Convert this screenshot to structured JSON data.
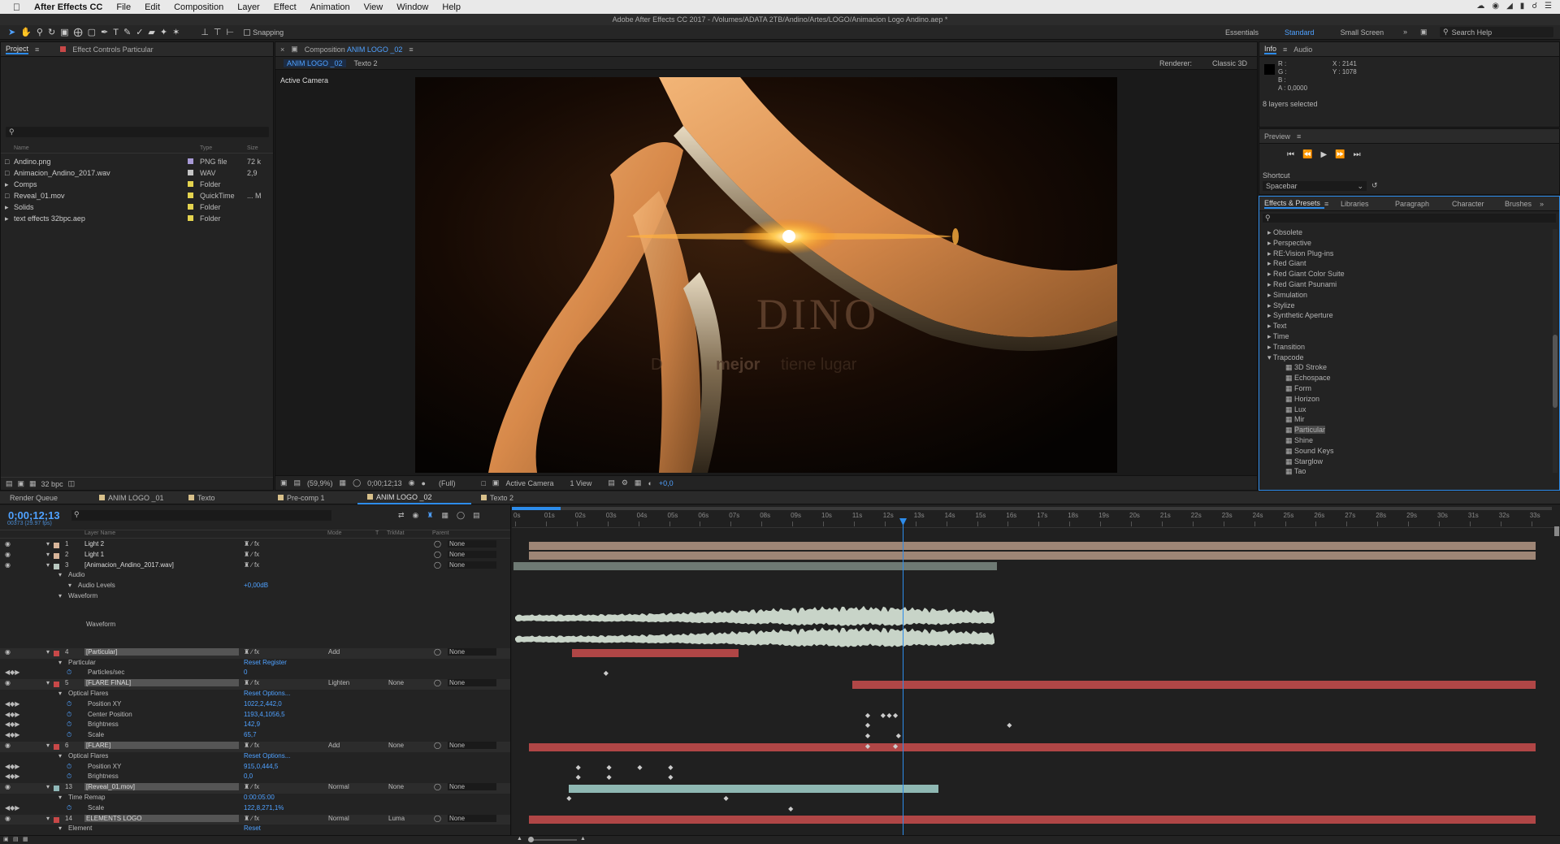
{
  "menubar": {
    "app": "After Effects CC",
    "items": [
      "File",
      "Edit",
      "Composition",
      "Layer",
      "Effect",
      "Animation",
      "View",
      "Window",
      "Help"
    ]
  },
  "window": {
    "title": "Adobe After Effects CC 2017 - /Volumes/ADATA 2TB/Andino/Artes/LOGO/Animacion Logo Andino.aep *"
  },
  "toolbar": {
    "snapping": "Snapping",
    "workspaces": [
      "Essentials",
      "Standard",
      "Small Screen"
    ],
    "search_help": "Search Help"
  },
  "project": {
    "tab": "Project",
    "effect_controls": "Effect Controls Particular",
    "columns": [
      "Name",
      "Type",
      "Size"
    ],
    "items": [
      {
        "name": "Andino.png",
        "type": "PNG file",
        "size": "72 k",
        "color": "#a89ad6",
        "folder": false
      },
      {
        "name": "Animacion_Andino_2017.wav",
        "type": "WAV",
        "size": "2,9",
        "color": "#c4c4c4",
        "folder": false
      },
      {
        "name": "Comps",
        "type": "Folder",
        "size": "",
        "color": "#e5d44f",
        "folder": true
      },
      {
        "name": "Reveal_01.mov",
        "type": "QuickTime",
        "size": "... M",
        "color": "#e5d44f",
        "folder": false
      },
      {
        "name": "Solids",
        "type": "Folder",
        "size": "",
        "color": "#e5d44f",
        "folder": true
      },
      {
        "name": "text effects 32bpc.aep",
        "type": "Folder",
        "size": "",
        "color": "#e5d44f",
        "folder": true
      }
    ],
    "bpc": "32 bpc"
  },
  "composition": {
    "tab_label": "Composition",
    "comp_name": "ANIM LOGO _02",
    "subtabs": [
      "ANIM LOGO _02",
      "Texto 2"
    ],
    "renderer_label": "Renderer:",
    "renderer": "Classic 3D",
    "camera_label": "Active Camera",
    "logo_text": "DINO",
    "tagline_a": "D",
    "tagline_b": "mejor",
    "tagline_c": "tiene lugar",
    "footer": {
      "zoom": "(59,9%)",
      "timecode": "0;00;12;13",
      "resolution": "(Full)",
      "camera": "Active Camera",
      "views": "1 View",
      "exposure": "+0,0"
    }
  },
  "info": {
    "tabs": [
      "Info",
      "Audio"
    ],
    "r": "R :",
    "g": "G :",
    "b": "B :",
    "a": "A : 0,0000",
    "x": "X : 2141",
    "y": "Y : 1078",
    "selected": "8 layers selected"
  },
  "preview": {
    "title": "Preview",
    "shortcut_label": "Shortcut",
    "shortcut": "Spacebar"
  },
  "effects": {
    "tabs": [
      "Effects & Presets",
      "Libraries",
      "Paragraph",
      "Character",
      "Brushes"
    ],
    "categories": [
      "Obsolete",
      "Perspective",
      "RE:Vision Plug-ins",
      "Red Giant",
      "Red Giant Color Suite",
      "Red Giant Psunami",
      "Simulation",
      "Stylize",
      "Synthetic Aperture",
      "Text",
      "Time",
      "Transition"
    ],
    "open_category": "Trapcode",
    "plugins": [
      "3D Stroke",
      "Echospace",
      "Form",
      "Horizon",
      "Lux",
      "Mir",
      "Particular",
      "Shine",
      "Sound Keys",
      "Starglow",
      "Tao"
    ],
    "selected": "Particular"
  },
  "timeline": {
    "tabs": [
      "Render Queue",
      "ANIM LOGO _01",
      "Texto",
      "Pre-comp 1",
      "ANIM LOGO _02",
      "Texto 2"
    ],
    "active_tab": "ANIM LOGO _02",
    "timecode": "0;00;12;13",
    "frames": "00373 (29.97 fps)",
    "columns": {
      "layer_name": "Layer Name",
      "mode": "Mode",
      "t": "T",
      "trkmat": "TrkMat",
      "parent": "Parent"
    },
    "ruler": [
      "0s",
      "01s",
      "02s",
      "03s",
      "04s",
      "05s",
      "06s",
      "07s",
      "08s",
      "09s",
      "10s",
      "11s",
      "12s",
      "13s",
      "14s",
      "15s",
      "16s",
      "17s",
      "18s",
      "19s",
      "20s",
      "21s",
      "22s",
      "23s",
      "24s",
      "25s",
      "26s",
      "27s",
      "28s",
      "29s",
      "30s",
      "31s",
      "32s",
      "33s"
    ],
    "rows": [
      {
        "kind": "layer",
        "num": "1",
        "name": "Light 2",
        "mode": "",
        "trk": "",
        "parent": "None",
        "color": "#d8b59a",
        "bar": {
          "start": 0.5,
          "end": 33.2,
          "color": "#9e8676"
        }
      },
      {
        "kind": "layer",
        "num": "2",
        "name": "Light 1",
        "mode": "",
        "trk": "",
        "parent": "None",
        "color": "#d8b59a",
        "bar": {
          "start": 0.5,
          "end": 33.2,
          "color": "#9e8676"
        }
      },
      {
        "kind": "layer",
        "num": "3",
        "name": "[Animacion_Andino_2017.wav]",
        "mode": "",
        "trk": "",
        "parent": "None",
        "color": "#b8c8c0",
        "bar": {
          "start": 0,
          "end": 15.7,
          "color": "#6e7a74"
        }
      },
      {
        "kind": "prop",
        "indent": 1,
        "name": "Audio"
      },
      {
        "kind": "prop",
        "indent": 2,
        "name": "Audio Levels",
        "value": "+0,00dB"
      },
      {
        "kind": "prop",
        "indent": 1,
        "name": "Waveform"
      },
      {
        "kind": "wave",
        "name": "Waveform"
      },
      {
        "kind": "layer",
        "num": "4",
        "name": "[Particular]",
        "mode": "Add",
        "trk": "",
        "parent": "None",
        "color": "#c84848",
        "bar": {
          "start": 1.9,
          "end": 7.3,
          "color": "#b04646"
        },
        "hl": true
      },
      {
        "kind": "prop",
        "indent": 1,
        "name": "Particular",
        "value": "Reset   Register"
      },
      {
        "kind": "prop",
        "indent": 3,
        "name": "Particles/sec",
        "value": "0"
      },
      {
        "kind": "layer",
        "num": "5",
        "name": "[FLARE FINAL]",
        "mode": "Lighten",
        "trk": "None",
        "parent": "None",
        "color": "#c84848",
        "bar": {
          "start": 11,
          "end": 33.2,
          "color": "#b04646"
        },
        "hl": true
      },
      {
        "kind": "prop",
        "indent": 1,
        "name": "Optical Flares",
        "value": "Reset   Options..."
      },
      {
        "kind": "prop",
        "indent": 3,
        "name": "Position XY",
        "value": "1022,2,442,0"
      },
      {
        "kind": "prop",
        "indent": 3,
        "name": "Center Position",
        "value": "1193,4,1056,5"
      },
      {
        "kind": "prop",
        "indent": 3,
        "name": "Brightness",
        "value": "142,9"
      },
      {
        "kind": "prop",
        "indent": 3,
        "name": "Scale",
        "value": "65,7"
      },
      {
        "kind": "layer",
        "num": "6",
        "name": "[FLARE]",
        "mode": "Add",
        "trk": "None",
        "parent": "None",
        "color": "#c84848",
        "bar": {
          "start": 0.5,
          "end": 33.2,
          "color": "#b04646"
        },
        "hl": true
      },
      {
        "kind": "prop",
        "indent": 1,
        "name": "Optical Flares",
        "value": "Reset   Options..."
      },
      {
        "kind": "prop",
        "indent": 3,
        "name": "Position XY",
        "value": "915,0,444,5"
      },
      {
        "kind": "prop",
        "indent": 3,
        "name": "Brightness",
        "value": "0,0"
      },
      {
        "kind": "layer",
        "num": "13",
        "name": "[Reveal_01.mov]",
        "mode": "Normal",
        "trk": "None",
        "parent": "None",
        "color": "#8fb8b8",
        "bar": {
          "start": 1.8,
          "end": 13.8,
          "color": "#8fb8b3"
        },
        "hl": true
      },
      {
        "kind": "prop",
        "indent": 1,
        "name": "Time Remap",
        "value": "0:00:05:00"
      },
      {
        "kind": "prop",
        "indent": 3,
        "name": "Scale",
        "value": "122,8,271,1%"
      },
      {
        "kind": "layer",
        "num": "14",
        "name": "ELEMENTS LOGO",
        "mode": "Normal",
        "trk": "Luma",
        "parent": "None",
        "color": "#c84848",
        "bar": {
          "start": 0.5,
          "end": 33.2,
          "color": "#b04646"
        },
        "hl": true
      },
      {
        "kind": "prop",
        "indent": 1,
        "name": "Element",
        "value": "Reset"
      }
    ]
  },
  "colors": {
    "accent": "#2d8ceb",
    "red_bar": "#b04646",
    "tan_bar": "#9e8676",
    "teal_bar": "#8fb8b3"
  }
}
